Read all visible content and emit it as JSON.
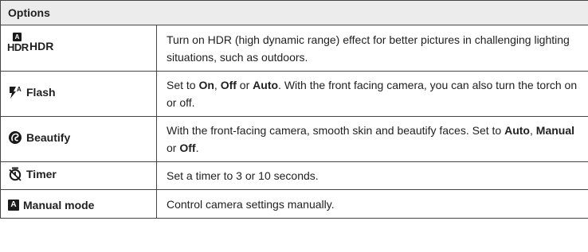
{
  "table": {
    "header": "Options",
    "rows": [
      {
        "icon": "hdr-icon",
        "label": "HDR",
        "description": [
          {
            "text": "Turn on HDR (high dynamic range) effect for better pictures in challenging lighting situations, such as outdoors.",
            "bold": false
          }
        ]
      },
      {
        "icon": "flash-auto-icon",
        "label": "Flash",
        "description": [
          {
            "text": "Set to ",
            "bold": false
          },
          {
            "text": "On",
            "bold": true
          },
          {
            "text": ", ",
            "bold": false
          },
          {
            "text": "Off",
            "bold": true
          },
          {
            "text": " or ",
            "bold": false
          },
          {
            "text": "Auto",
            "bold": true
          },
          {
            "text": ". With the front facing camera, you can also turn the torch on or off.",
            "bold": false
          }
        ]
      },
      {
        "icon": "beautify-icon",
        "label": "Beautify",
        "description": [
          {
            "text": "With the front-facing camera, smooth skin and beautify faces. Set to ",
            "bold": false
          },
          {
            "text": "Auto",
            "bold": true
          },
          {
            "text": ", ",
            "bold": false
          },
          {
            "text": "Manual",
            "bold": true
          },
          {
            "text": " or ",
            "bold": false
          },
          {
            "text": "Off",
            "bold": true
          },
          {
            "text": ".",
            "bold": false
          }
        ]
      },
      {
        "icon": "timer-icon",
        "label": "Timer",
        "description": [
          {
            "text": "Set a timer to 3 or 10 seconds.",
            "bold": false
          }
        ]
      },
      {
        "icon": "manual-mode-icon",
        "label": "Manual mode",
        "description": [
          {
            "text": "Control camera settings manually.",
            "bold": false
          }
        ]
      }
    ],
    "icon_glyphs": {
      "hdr_badge": "A",
      "hdr_text": "HDR",
      "flash_sup": "A",
      "manual_badge": "A"
    }
  }
}
